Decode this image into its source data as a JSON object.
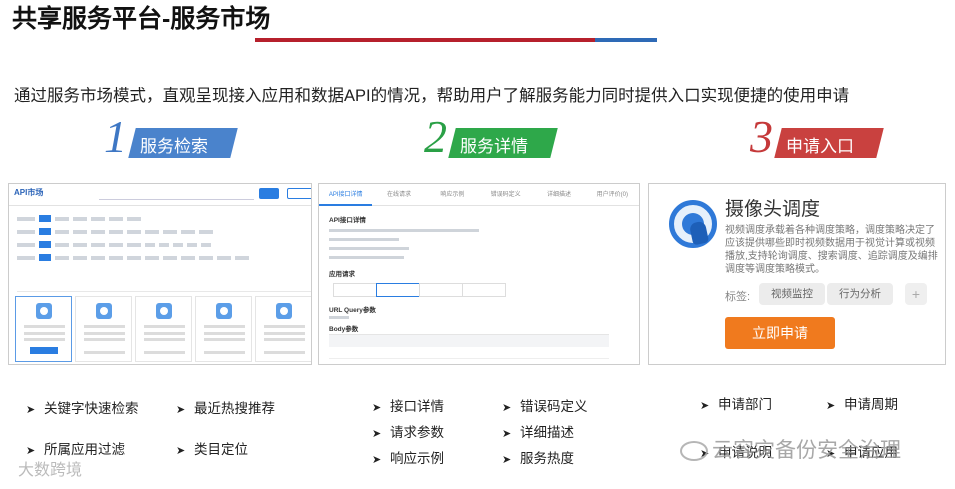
{
  "header": {
    "title": "共享服务平台-服务市场",
    "subtitle": "通过服务市场模式，直观呈现接入应用和数据API的情况，帮助用户了解服务能力同时提供入口实现便捷的使用申请"
  },
  "steps": [
    {
      "num": "1",
      "label": "服务检索",
      "color": "#3e77c4",
      "tag_color": "#4a83cc"
    },
    {
      "num": "2",
      "label": "服务详情",
      "color": "#2aa046",
      "tag_color": "#2ea84a"
    },
    {
      "num": "3",
      "label": "申请入口",
      "color": "#c5393a",
      "tag_color": "#c9413f"
    }
  ],
  "shot1": {
    "logo": "API市场"
  },
  "shot2": {
    "tabs": [
      "API接口详情",
      "在线请求",
      "响应示例",
      "错误码定义",
      "详细描述",
      "用户评价(0)"
    ],
    "section_title": "API接口详情",
    "params_title": "应用请求",
    "query_title": "URL Query参数",
    "body_title": "Body参数"
  },
  "shot3": {
    "title": "摄像头调度",
    "description": "视频调度承载着各种调度策略，调度策略决定了应该提供哪些即时视频数据用于视觉计算或视频播放,支持轮询调度、搜索调度、追踪调度及编排调度等调度策略模式。",
    "tags_label": "标签:",
    "tags": [
      "视频监控",
      "行为分析"
    ],
    "plus": "+",
    "apply_button": "立即申请"
  },
  "features": {
    "col1": [
      "关键字快速检索",
      "最近热搜推荐",
      "所属应用过滤",
      "类目定位"
    ],
    "col2": [
      "接口详情",
      "错误码定义",
      "请求参数",
      "详细描述",
      "响应示例",
      "服务热度"
    ],
    "col3": [
      "申请部门",
      "申请周期",
      "申请说明",
      "申请应用"
    ]
  },
  "watermarks": {
    "left": "大数跨境",
    "right": "云容灾备份安全治理"
  }
}
